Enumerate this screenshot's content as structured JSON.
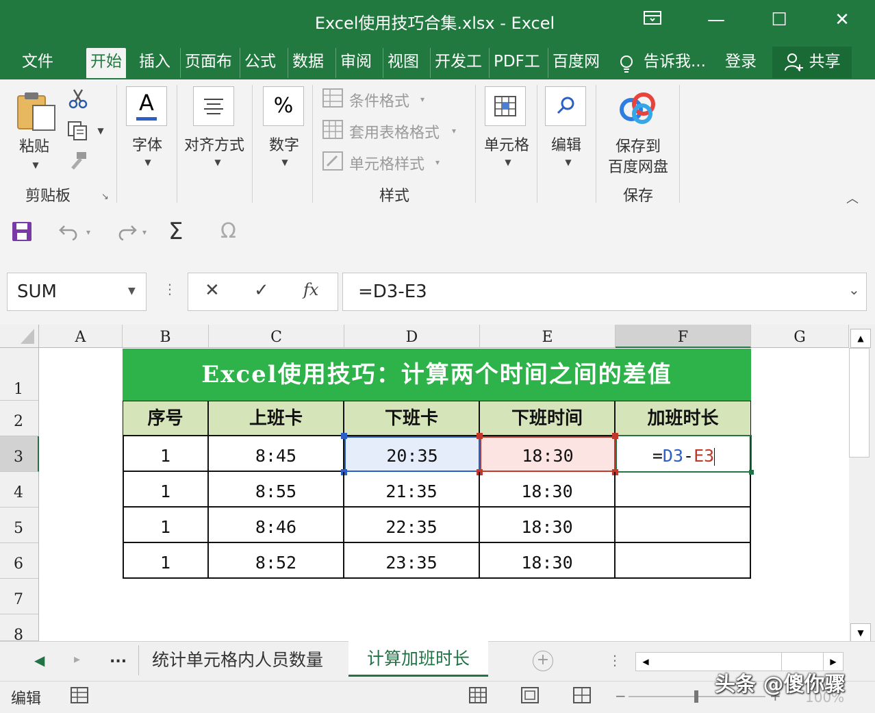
{
  "titlebar": {
    "title": "Excel使用技巧合集.xlsx  -  Excel",
    "ribbon_display_icon": "ribbon-display-icon",
    "minimize": "—",
    "maximize": "☐",
    "close": "✕"
  },
  "tabs": [
    {
      "label": "文件"
    },
    {
      "label": "开始"
    },
    {
      "label": "插入"
    },
    {
      "label": "页面布"
    },
    {
      "label": "公式"
    },
    {
      "label": "数据"
    },
    {
      "label": "审阅"
    },
    {
      "label": "视图"
    },
    {
      "label": "开发工"
    },
    {
      "label": "PDF工"
    },
    {
      "label": "百度网"
    },
    {
      "label": "告诉我..."
    },
    {
      "label": "登录"
    },
    {
      "label": "共享"
    }
  ],
  "ribbon": {
    "paste_label": "粘贴",
    "clipboard_group": "剪贴板",
    "font_label": "字体",
    "align_label": "对齐方式",
    "number_label": "数字",
    "cond_format": "条件格式",
    "table_format": "套用表格格式",
    "cell_style": "单元格样式",
    "styles_group": "样式",
    "cells_label": "单元格",
    "edit_label": "编辑",
    "save_line1": "保存到",
    "save_line2": "百度网盘",
    "save_group": "保存",
    "font_glyph": "A",
    "number_glyph": "%"
  },
  "formula_bar": {
    "name_box": "SUM",
    "cancel": "✕",
    "enter": "✓",
    "fx": "fx",
    "formula": "=D3-E3"
  },
  "columns": [
    "A",
    "B",
    "C",
    "D",
    "E",
    "F",
    "G"
  ],
  "rows": [
    "1",
    "2",
    "3",
    "4",
    "5",
    "6",
    "7",
    "8"
  ],
  "sheet": {
    "title": "Excel使用技巧：计算两个时间之间的差值",
    "headers": [
      "序号",
      "上班卡",
      "下班卡",
      "下班时间",
      "加班时长"
    ],
    "data": [
      [
        "1",
        "8:45",
        "20:35",
        "18:30"
      ],
      [
        "1",
        "8:55",
        "21:35",
        "18:30"
      ],
      [
        "1",
        "8:46",
        "22:35",
        "18:30"
      ],
      [
        "1",
        "8:52",
        "23:35",
        "18:30"
      ]
    ],
    "edit_eq": "=",
    "edit_ref1": "D3",
    "edit_minus": "-",
    "edit_ref2": "E3"
  },
  "sheet_tabs": {
    "more": "...",
    "tab1": "统计单元格内人员数量",
    "tab2": "计算加班时长",
    "add": "+"
  },
  "status": {
    "mode": "编辑",
    "zoom": "100%"
  },
  "watermark": "头条 @傻你骤",
  "colors": {
    "title_green": "#21793f",
    "header_fill": "#d6e4b9",
    "banner_green": "#2db34a",
    "ref_blue": "#2b5fc4",
    "ref_red": "#c0392b"
  }
}
